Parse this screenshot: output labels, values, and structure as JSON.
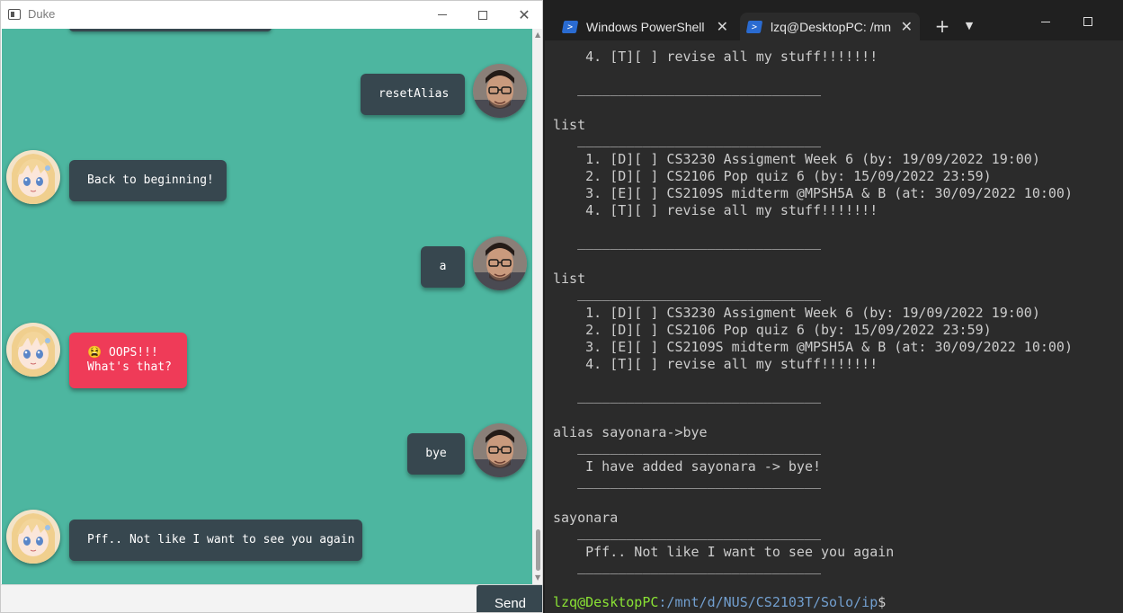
{
  "duke": {
    "title": "Duke",
    "controls": {
      "minimize": "—",
      "maximize": "☐",
      "close": "✕"
    },
    "messages": [
      {
        "sender": "user",
        "text": "resetAlias"
      },
      {
        "sender": "duke",
        "text": "Back to beginning!"
      },
      {
        "sender": "user",
        "text": "a"
      },
      {
        "sender": "duke",
        "text": "😫 OOPS!!!\nWhat's that?",
        "error": true
      },
      {
        "sender": "user",
        "text": "bye"
      },
      {
        "sender": "duke",
        "text": "Pff.. Not like I want to see you again"
      }
    ],
    "input": {
      "value": "",
      "placeholder": ""
    },
    "send_label": "Send",
    "colors": {
      "background": "#4db6a0",
      "bubble": "#37474f",
      "error_bubble": "#ef3b58"
    }
  },
  "terminal": {
    "tabs": [
      {
        "label": "Windows PowerShell",
        "active": false
      },
      {
        "label": "lzq@DesktopPC: /mn",
        "active": true
      }
    ],
    "lines": [
      "    4. [T][ ] revise all my stuff!!!!!!!",
      "",
      "   ______________________________",
      "",
      "list",
      "   ______________________________",
      "    1. [D][ ] CS3230 Assigment Week 6 (by: 19/09/2022 19:00)",
      "    2. [D][ ] CS2106 Pop quiz 6 (by: 15/09/2022 23:59)",
      "    3. [E][ ] CS2109S midterm @MPSH5A & B (at: 30/09/2022 10:00)",
      "    4. [T][ ] revise all my stuff!!!!!!!",
      "",
      "   ______________________________",
      "",
      "list",
      "   ______________________________",
      "    1. [D][ ] CS3230 Assigment Week 6 (by: 19/09/2022 19:00)",
      "    2. [D][ ] CS2106 Pop quiz 6 (by: 15/09/2022 23:59)",
      "    3. [E][ ] CS2109S midterm @MPSH5A & B (at: 30/09/2022 10:00)",
      "    4. [T][ ] revise all my stuff!!!!!!!",
      "",
      "   ______________________________",
      "",
      "alias sayonara->bye",
      "   ______________________________",
      "    I have added sayonara -> bye!",
      "   ______________________________",
      "",
      "sayonara",
      "   ______________________________",
      "    Pff.. Not like I want to see you again",
      "   ______________________________",
      ""
    ],
    "prompt": {
      "user": "lzq@DesktopPC",
      "path": ":/mnt/d/NUS/CS2103T/Solo/ip",
      "symbol": "$"
    },
    "colors": {
      "background": "#2b2b2b",
      "text": "#cccccc",
      "prompt_user": "#8ae234",
      "prompt_path": "#729fcf"
    }
  }
}
